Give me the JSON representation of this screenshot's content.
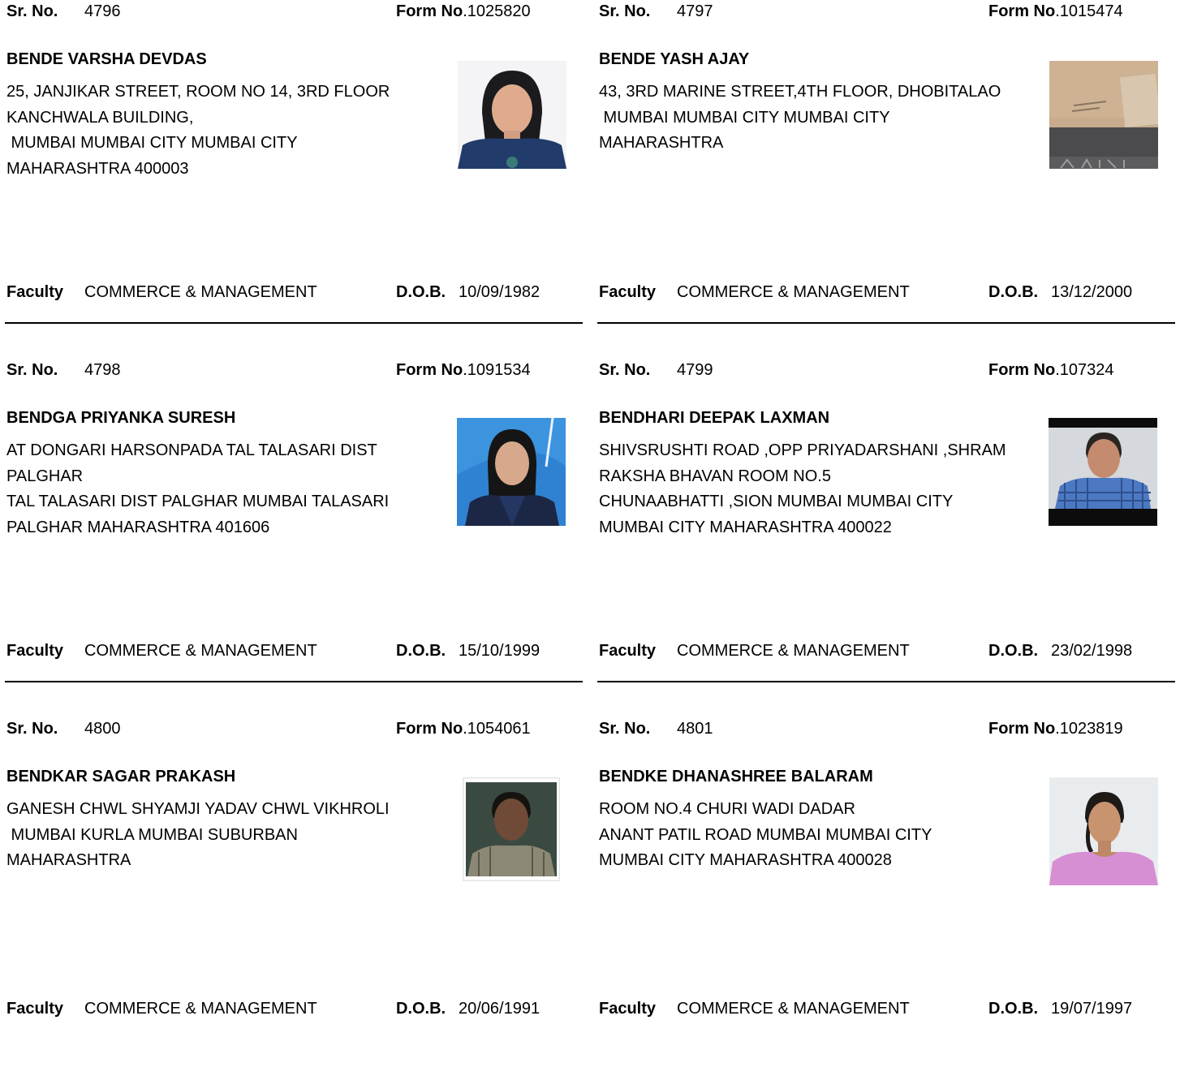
{
  "labels": {
    "sr_no": "Sr. No.",
    "form_no": "Form No",
    "faculty": "Faculty",
    "dob": "D.O.B."
  },
  "records": [
    {
      "sr_no": "4796",
      "form_no": ".1025820",
      "name": "BENDE VARSHA DEVDAS",
      "address_lines": [
        "25, JANJIKAR STREET, ROOM NO 14, 3RD FLOOR",
        "KANCHWALA BUILDING,",
        " MUMBAI MUMBAI CITY MUMBAI CITY",
        "MAHARASHTRA 400003"
      ],
      "faculty": "COMMERCE & MANAGEMENT",
      "dob": "10/09/1982",
      "photo": "woman-blue-top-portrait"
    },
    {
      "sr_no": "4797",
      "form_no": ".1015474",
      "name": "BENDE YASH AJAY",
      "address_lines": [
        "43, 3RD MARINE STREET,4TH FLOOR, DHOBITALAO",
        " MUMBAI MUMBAI CITY MUMBAI CITY",
        "MAHARASHTRA"
      ],
      "faculty": "COMMERCE & MANAGEMENT",
      "dob": "13/12/2000",
      "photo": "paper-bag-photo"
    },
    {
      "sr_no": "4798",
      "form_no": ".1091534",
      "name": "BENDGA PRIYANKA SURESH",
      "address_lines": [
        "AT DONGARI HARSONPADA TAL TALASARI DIST",
        "PALGHAR",
        "TAL TALASARI DIST PALGHAR MUMBAI TALASARI",
        "PALGHAR MAHARASHTRA 401606"
      ],
      "faculty": "COMMERCE & MANAGEMENT",
      "dob": "15/10/1999",
      "photo": "woman-blue-background-portrait"
    },
    {
      "sr_no": "4799",
      "form_no": ".107324",
      "name": "BENDHARI DEEPAK LAXMAN",
      "address_lines": [
        "SHIVSRUSHTI ROAD ,OPP PRIYADARSHANI ,SHRAM",
        "RAKSHA BHAVAN ROOM NO.5",
        "CHUNAABHATTI ,SION MUMBAI MUMBAI CITY",
        "MUMBAI CITY MAHARASHTRA 400022"
      ],
      "faculty": "COMMERCE & MANAGEMENT",
      "dob": "23/02/1998",
      "photo": "man-checked-shirt-portrait"
    },
    {
      "sr_no": "4800",
      "form_no": ".1054061",
      "name": "BENDKAR SAGAR PRAKASH",
      "address_lines": [
        "GANESH CHWL SHYAMJI YADAV CHWL VIKHROLI",
        " MUMBAI KURLA MUMBAI SUBURBAN",
        "MAHARASHTRA"
      ],
      "faculty": "COMMERCE & MANAGEMENT",
      "dob": "20/06/1991",
      "photo": "man-dark-portrait"
    },
    {
      "sr_no": "4801",
      "form_no": ".1023819",
      "name": "BENDKE DHANASHREE BALARAM",
      "address_lines": [
        "ROOM NO.4 CHURI WADI DADAR",
        "ANANT PATIL ROAD MUMBAI MUMBAI CITY",
        "MUMBAI CITY MAHARASHTRA 400028"
      ],
      "faculty": "COMMERCE & MANAGEMENT",
      "dob": "19/07/1997",
      "photo": "woman-pink-top-portrait"
    }
  ]
}
